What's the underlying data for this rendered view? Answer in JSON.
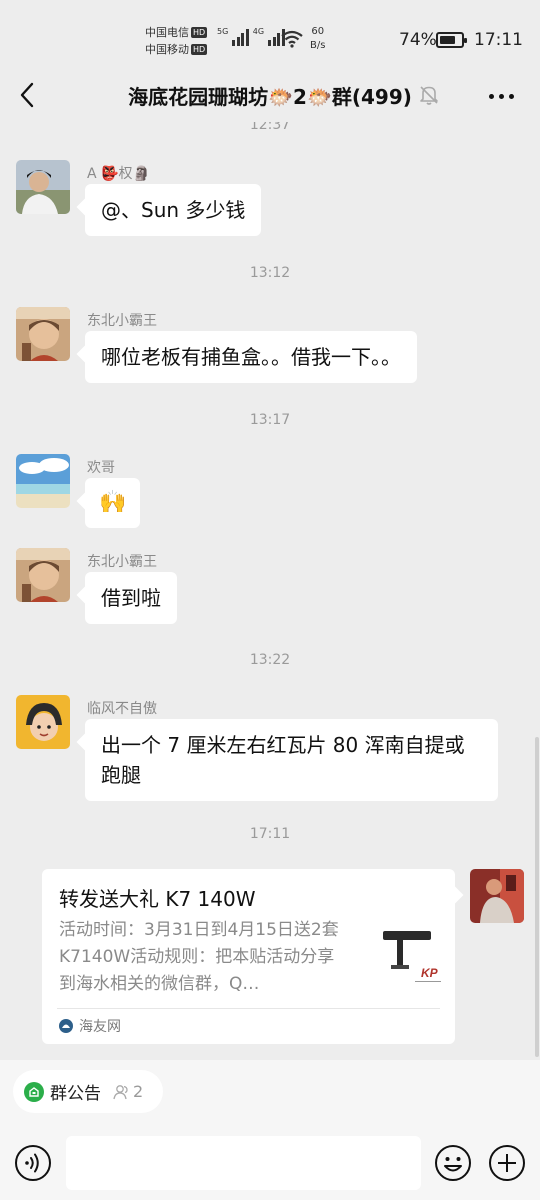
{
  "status_bar": {
    "carrier1": "中国电信",
    "carrier2": "中国移动",
    "hd": "HD",
    "net1": "5G",
    "net2": "4G",
    "speed_value": "60",
    "speed_unit": "B/s",
    "battery": "74%",
    "battery_level": 0.74,
    "time": "17:11"
  },
  "header": {
    "title": "海底花园珊瑚坊🐡2🐡群(499)",
    "icons": [
      "back-arrow-icon",
      "mute-bell-icon",
      "more-icon"
    ]
  },
  "chat": {
    "partial_timestamp": "12:37",
    "messages": [
      {
        "sender": "A 👺权🗿",
        "text": "@、Sun  多少钱"
      },
      {
        "timestamp": "13:12"
      },
      {
        "sender": "东北小霸王",
        "text": "哪位老板有捕鱼盒。。借我一下。。"
      },
      {
        "timestamp": "13:17"
      },
      {
        "sender": "欢哥",
        "text": "🙌"
      },
      {
        "sender": "东北小霸王",
        "text": "借到啦"
      },
      {
        "timestamp": "13:22"
      },
      {
        "sender": "临风不自傲",
        "text": "出一个 7 厘米左右红瓦片 80 浑南自提或跑腿"
      },
      {
        "timestamp": "17:11"
      }
    ],
    "link_card": {
      "title": "转发送大礼 K7 140W",
      "description": "活动时间：3月31日到4月15日送2套K7140W活动规则：把本贴活动分享到海水相关的微信群，Q…",
      "source": "海友网",
      "thumb_brand": "KP"
    }
  },
  "bottom": {
    "notice_label": "群公告",
    "notice_count": "2",
    "input_placeholder": ""
  },
  "colors": {
    "background": "#ededed",
    "bubble": "#ffffff",
    "notice_green": "#2bae4a"
  }
}
